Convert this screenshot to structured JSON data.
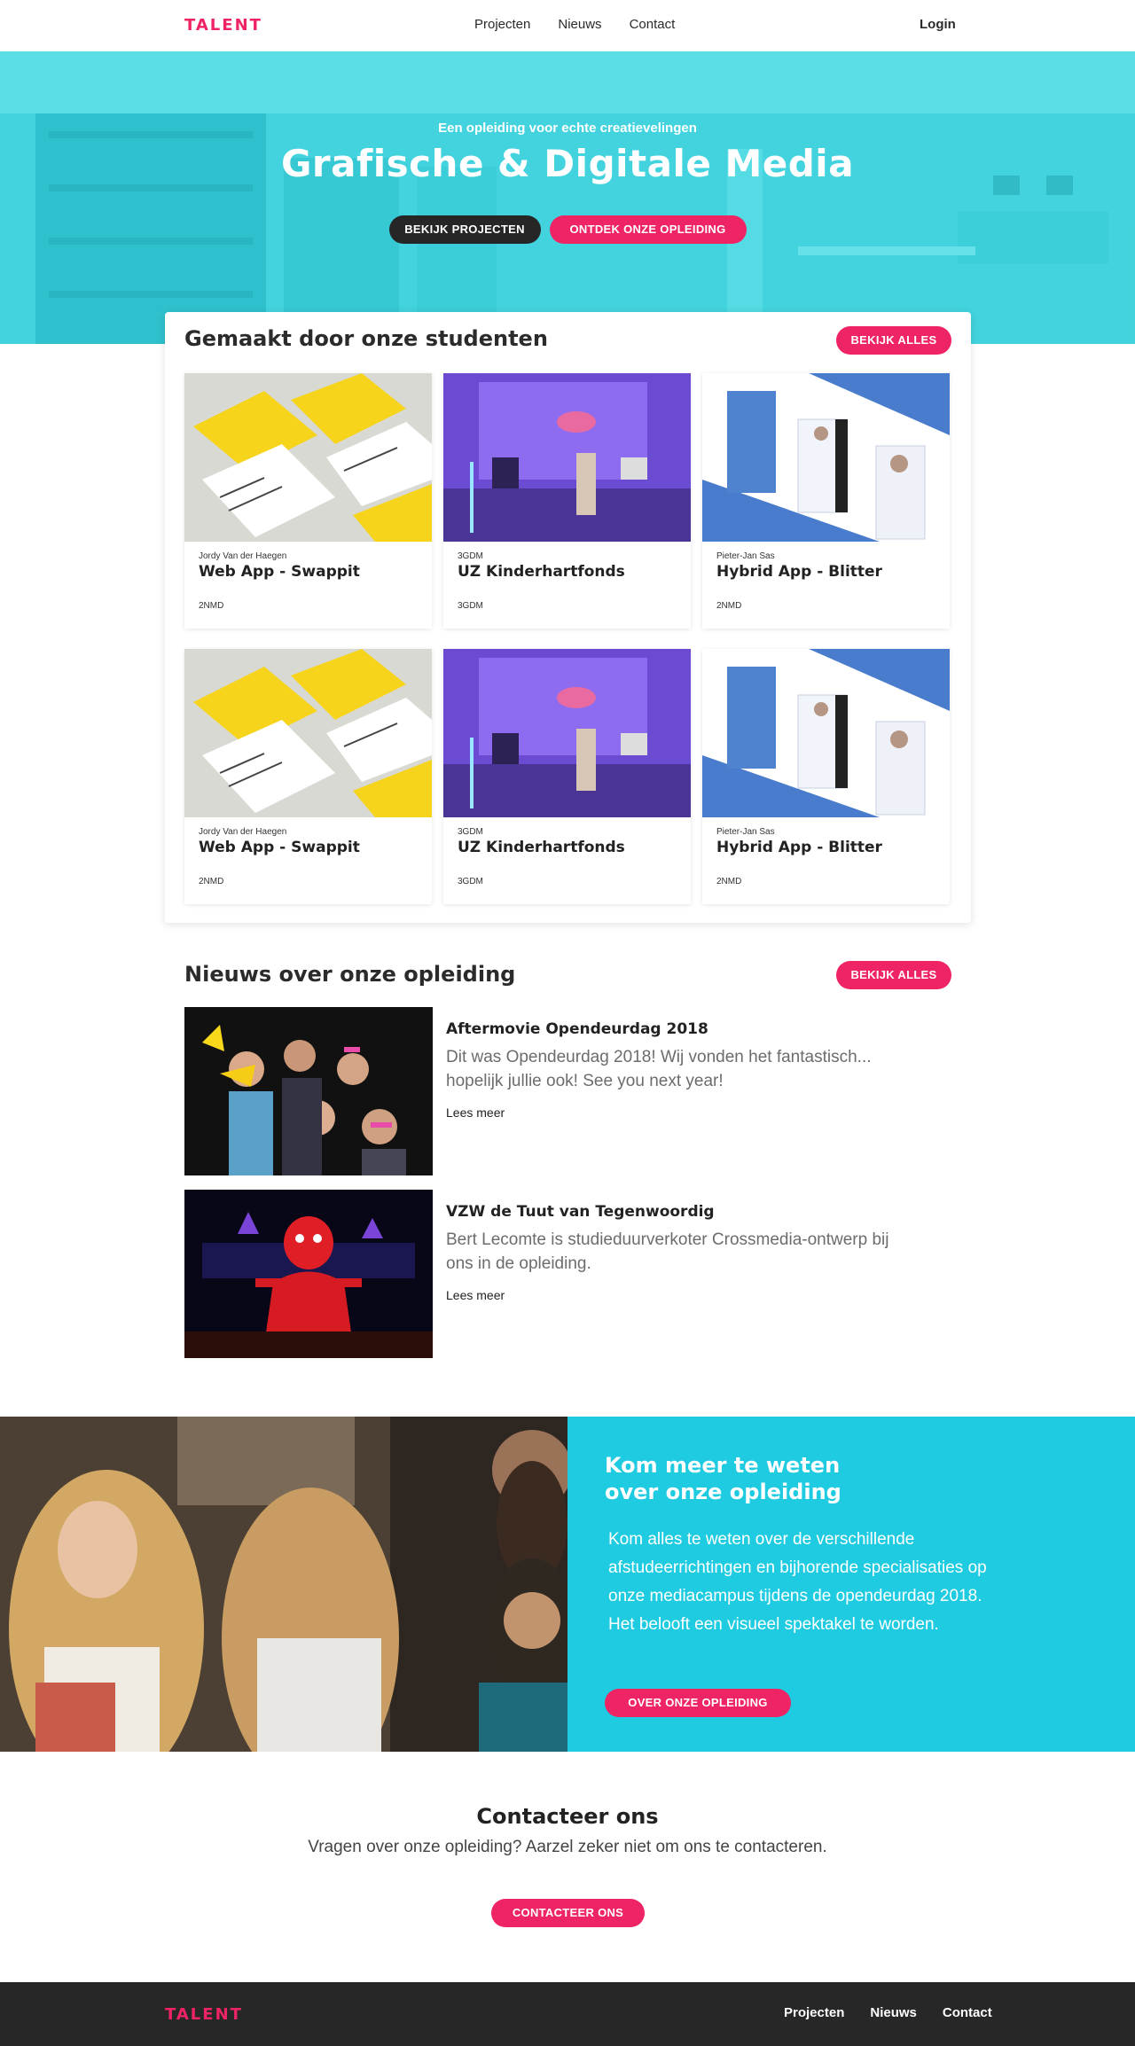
{
  "header": {
    "logo": "TALENT",
    "nav": [
      "Projecten",
      "Nieuws",
      "Contact"
    ],
    "login": "Login"
  },
  "hero": {
    "subtitle": "Een opleiding voor echte creatievelingen",
    "title": "Grafische & Digitale Media",
    "btn_projects": "BEKIJK PROJECTEN",
    "btn_discover": "ONTDEK ONZE OPLEIDING"
  },
  "projects": {
    "title": "Gemaakt door onze studenten",
    "btn_all": "BEKIJK ALLES",
    "items": [
      {
        "meta": "Jordy Van der Haegen",
        "name": "Web App - Swappit",
        "tag": "2NMD",
        "image": "yellow-cv-mockup"
      },
      {
        "meta": "3GDM",
        "name": "UZ Kinderhartfonds",
        "tag": "3GDM",
        "image": "purple-lab-room"
      },
      {
        "meta": "Pieter-Jan Sas",
        "name": "Hybrid App - Blitter",
        "tag": "2NMD",
        "image": "blue-app-screens"
      },
      {
        "meta": "Jordy Van der Haegen",
        "name": "Web App - Swappit",
        "tag": "2NMD",
        "image": "yellow-cv-mockup"
      },
      {
        "meta": "3GDM",
        "name": "UZ Kinderhartfonds",
        "tag": "3GDM",
        "image": "purple-lab-room"
      },
      {
        "meta": "Pieter-Jan Sas",
        "name": "Hybrid App - Blitter",
        "tag": "2NMD",
        "image": "blue-app-screens"
      }
    ]
  },
  "news": {
    "title": "Nieuws over onze opleiding",
    "btn_all": "BEKIJK ALLES",
    "items": [
      {
        "title": "Aftermovie Opendeurdag 2018",
        "text": "Dit was Opendeurdag 2018! Wij vonden het fantastisch... hopelijk jullie ook! See you next year!",
        "more": "Lees meer"
      },
      {
        "title": "VZW de Tuut van Tegenwoordig",
        "text": "Bert Lecomte is studieduurverkoter Crossmedia-ontwerp bij ons in de opleiding.",
        "more": "Lees meer"
      }
    ]
  },
  "info": {
    "title": "Kom meer te weten over onze opleiding",
    "text": "Kom alles te weten over de verschillende afstudeerrichtingen en bijhorende specialisaties op onze mediacampus tijdens de opendeurdag 2018. Het belooft een visueel spektakel te worden.",
    "btn": "OVER ONZE OPLEIDING"
  },
  "contact": {
    "title": "Contacteer ons",
    "text": "Vragen over onze opleiding? Aarzel zeker niet om ons te contacteren.",
    "btn": "CONTACTEER ONS"
  },
  "footer": {
    "logo": "TALENT",
    "nav": [
      "Projecten",
      "Nieuws",
      "Contact"
    ]
  },
  "colors": {
    "accent": "#ef2464",
    "cyan": "#1ecbe1",
    "dark": "#272727"
  }
}
